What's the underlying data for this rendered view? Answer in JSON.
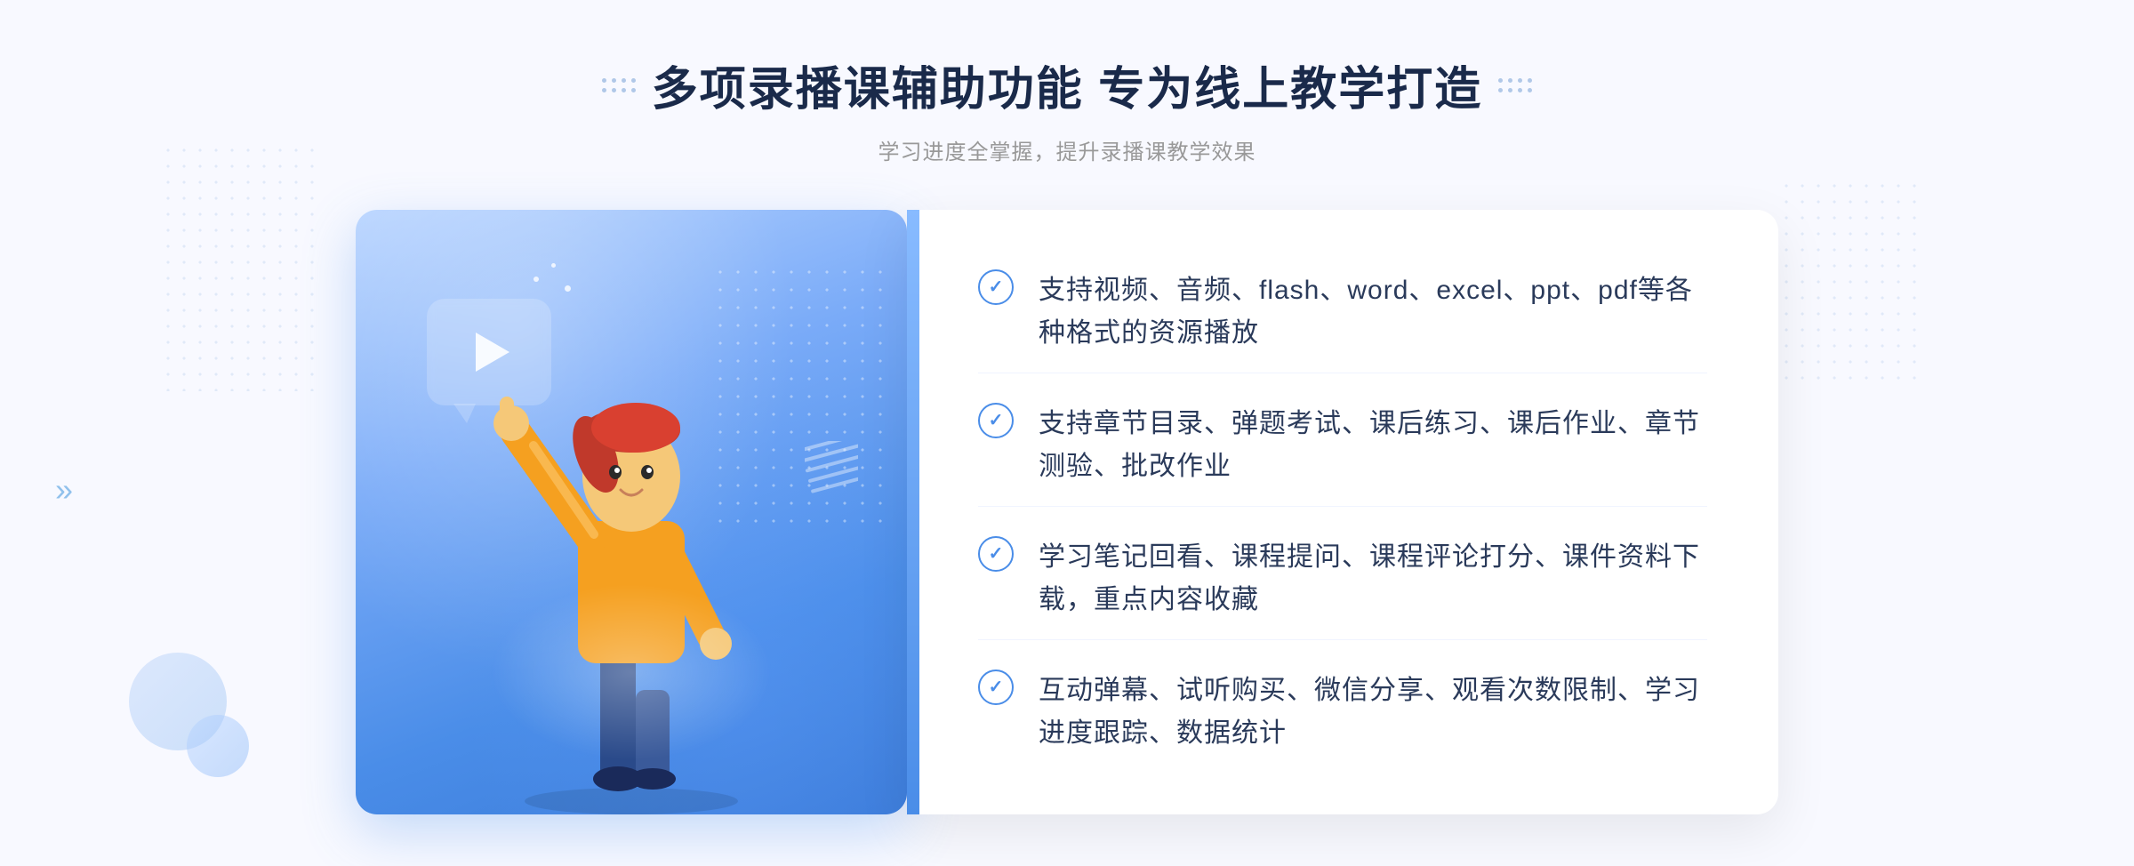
{
  "page": {
    "background_color": "#f5f7ff"
  },
  "header": {
    "main_title": "多项录播课辅助功能 专为线上教学打造",
    "subtitle": "学习进度全掌握，提升录播课教学效果"
  },
  "features": [
    {
      "id": 1,
      "text": "支持视频、音频、flash、word、excel、ppt、pdf等各种格式的资源播放"
    },
    {
      "id": 2,
      "text": "支持章节目录、弹题考试、课后练习、课后作业、章节测验、批改作业"
    },
    {
      "id": 3,
      "text": "学习笔记回看、课程提问、课程评论打分、课件资料下载，重点内容收藏"
    },
    {
      "id": 4,
      "text": "互动弹幕、试听购买、微信分享、观看次数限制、学习进度跟踪、数据统计"
    }
  ],
  "icons": {
    "play": "▶",
    "chevron": "»",
    "check": "✓"
  },
  "colors": {
    "primary_blue": "#4a8de8",
    "light_blue": "#7aabf8",
    "text_dark": "#1a2a4a",
    "text_medium": "#2a3a5a",
    "text_light": "#999999"
  }
}
